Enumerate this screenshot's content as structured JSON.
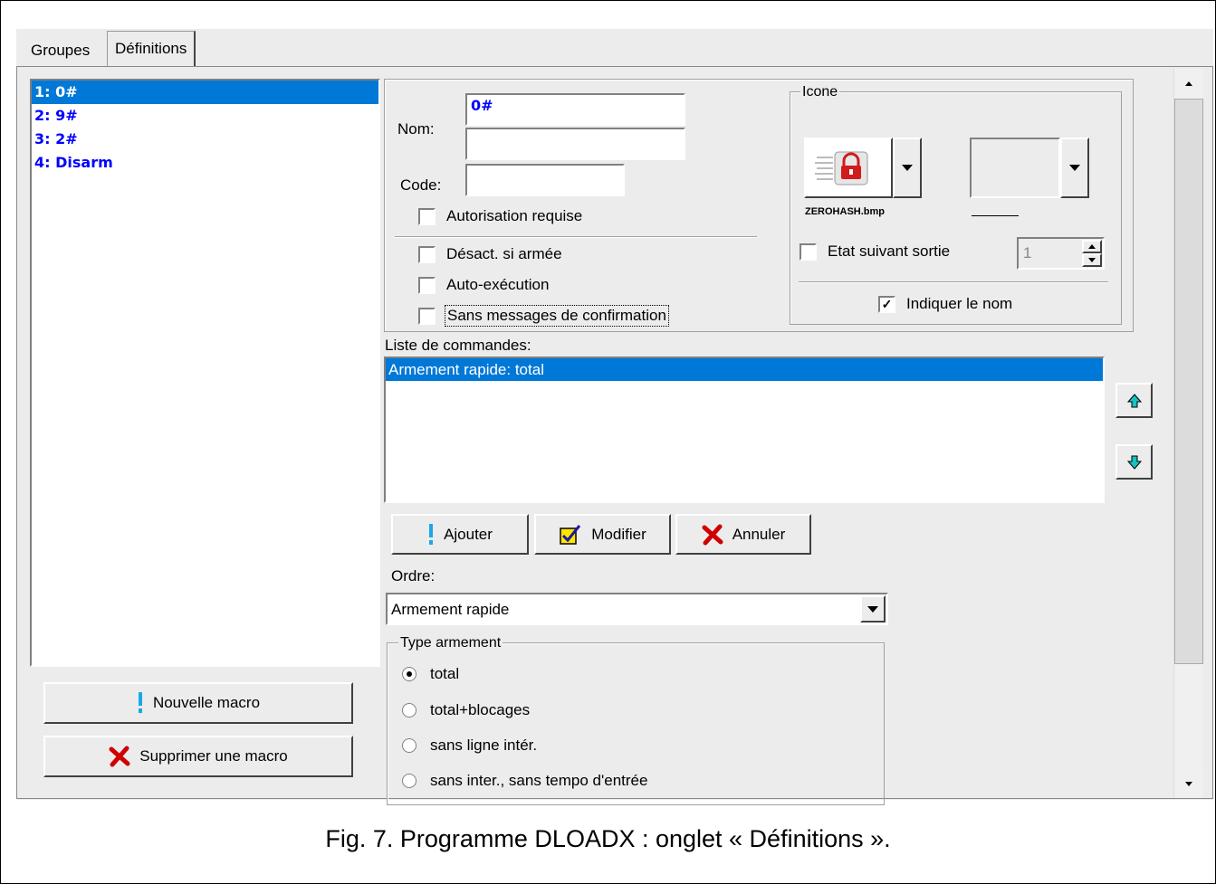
{
  "tabs": [
    "Groupes",
    "Définitions"
  ],
  "macros": [
    {
      "label": "1: 0#",
      "selected": true
    },
    {
      "label": "2: 9#"
    },
    {
      "label": "3: 2#"
    },
    {
      "label": "4: Disarm"
    }
  ],
  "buttons": {
    "new_macro": "Nouvelle macro",
    "delete_macro": "Supprimer une macro",
    "add": "Ajouter",
    "modify": "Modifier",
    "cancel": "Annuler"
  },
  "form": {
    "name_label": "Nom:",
    "name_value": "0#",
    "name_value2": "",
    "code_label": "Code:",
    "code_value": "",
    "auth_required": "Autorisation requise",
    "disable_if_armed": "Désact. si armée",
    "auto_exec": "Auto-exécution",
    "no_confirm": "Sans messages de confirmation"
  },
  "icon_group": {
    "title": "Icone",
    "file_name": "ZEROHASH.bmp",
    "next_state_label": "Etat suivant sortie",
    "next_state_value": "1",
    "show_name_label": "Indiquer le nom",
    "show_name_checked": true,
    "lock_color": "#d01c1c"
  },
  "commands": {
    "label": "Liste de commandes:",
    "items": [
      "Armement rapide: total"
    ]
  },
  "order": {
    "label": "Ordre:",
    "selected": "Armement rapide"
  },
  "arm_type": {
    "title": "Type armement",
    "options": [
      "total",
      "total+blocages",
      "sans ligne intér.",
      "sans inter., sans tempo d'entrée"
    ],
    "selected_index": 0
  },
  "caption": "Fig. 7. Programme DLOADX : onglet « Définitions »."
}
